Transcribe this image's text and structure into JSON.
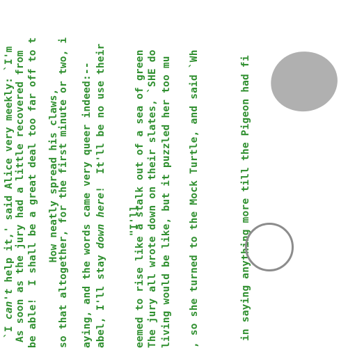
{
  "colors": {
    "text": "#2f8f2f",
    "blob": "#b0b0b0",
    "ring": "#8c8c8c"
  },
  "lines": [
    {
      "segments": [
        {
          "text": "`I ",
          "italic": false
        },
        {
          "text": "can't",
          "italic": true
        },
        {
          "text": " help it,' said Alice very meekly: `I'm",
          "italic": false
        }
      ]
    },
    {
      "segments": [
        {
          "text": "As soon as the jury had a little recovered from",
          "italic": false
        }
      ]
    },
    {
      "segments": [
        {
          "text": "be able!  I shall be a great deal too far off to t",
          "italic": false
        }
      ]
    },
    {
      "segments": [
        {
          "text": "      How neatly spread his claws,",
          "italic": false
        }
      ]
    },
    {
      "segments": [
        {
          "text": "so that altogether, for the first minute or two, i",
          "italic": false
        }
      ]
    },
    {
      "segments": [
        {
          "text": "aying, and the words came very queer indeed:--",
          "italic": false
        }
      ]
    },
    {
      "segments": [
        {
          "text": "abel, I'll stay ",
          "italic": false
        },
        {
          "text": "down here",
          "italic": true
        },
        {
          "text": "!  It'll be no use their",
          "italic": false
        }
      ]
    },
    {
      "segments": [
        {
          "text": "                  \"I'll",
          "italic": false
        }
      ]
    },
    {
      "segments": [
        {
          "text": "eemed to rise like a stalk out of a sea of green",
          "italic": false
        }
      ]
    },
    {
      "segments": [
        {
          "text": "The jury all wrote down on their slates, `SHE do",
          "italic": false
        }
      ]
    },
    {
      "segments": [
        {
          "text": "living would be like, but it puzzled her too mu",
          "italic": false
        }
      ]
    },
    {
      "segments": [
        {
          "text": ", so she turned to the Mock Turtle, and said `Wh",
          "italic": false
        }
      ]
    },
    {
      "segments": [
        {
          "text": "in saying anything more till the Pigeon had fi",
          "italic": false
        }
      ]
    }
  ]
}
